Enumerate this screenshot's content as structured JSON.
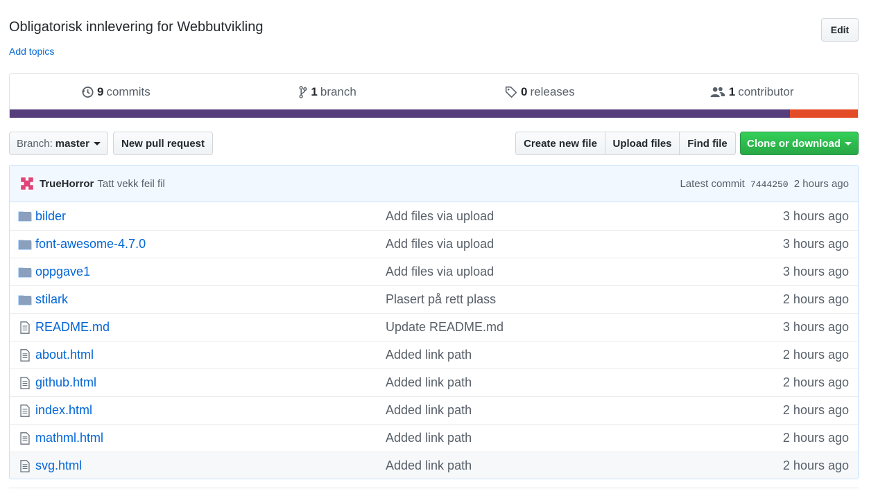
{
  "repo": {
    "description": "Obligatorisk innlevering for Webbutvikling",
    "add_topics": "Add topics",
    "edit_label": "Edit"
  },
  "summary": {
    "commits": {
      "count": "9",
      "label": "commits"
    },
    "branches": {
      "count": "1",
      "label": "branch"
    },
    "releases": {
      "count": "0",
      "label": "releases"
    },
    "contributors": {
      "count": "1",
      "label": "contributor"
    }
  },
  "languages": [
    {
      "color": "#563d7c",
      "share": 0.92
    },
    {
      "color": "#e34c26",
      "share": 0.08
    }
  ],
  "toolbar": {
    "branch_label": "Branch:",
    "branch_name": "master",
    "new_pr": "New pull request",
    "create_file": "Create new file",
    "upload_files": "Upload files",
    "find_file": "Find file",
    "clone": "Clone or download"
  },
  "latest_commit": {
    "author": "TrueHorror",
    "message": "Tatt vekk feil fil",
    "prefix": "Latest commit",
    "sha": "7444250",
    "age": "2 hours ago"
  },
  "files": [
    {
      "type": "dir",
      "name": "bilder",
      "message": "Add files via upload",
      "age": "3 hours ago"
    },
    {
      "type": "dir",
      "name": "font-awesome-4.7.0",
      "message": "Add files via upload",
      "age": "3 hours ago"
    },
    {
      "type": "dir",
      "name": "oppgave1",
      "message": "Add files via upload",
      "age": "3 hours ago"
    },
    {
      "type": "dir",
      "name": "stilark",
      "message": "Plasert på rett plass",
      "age": "2 hours ago"
    },
    {
      "type": "file",
      "name": "README.md",
      "message": "Update README.md",
      "age": "3 hours ago"
    },
    {
      "type": "file",
      "name": "about.html",
      "message": "Added link path",
      "age": "2 hours ago"
    },
    {
      "type": "file",
      "name": "github.html",
      "message": "Added link path",
      "age": "2 hours ago"
    },
    {
      "type": "file",
      "name": "index.html",
      "message": "Added link path",
      "age": "2 hours ago"
    },
    {
      "type": "file",
      "name": "mathml.html",
      "message": "Added link path",
      "age": "2 hours ago"
    },
    {
      "type": "file",
      "name": "svg.html",
      "message": "Added link path",
      "age": "2 hours ago"
    }
  ],
  "icons": {
    "commits": "history-icon",
    "branch": "git-branch-icon",
    "releases": "tag-icon",
    "contributors": "people-icon",
    "dir": "folder-icon",
    "file": "file-icon"
  }
}
